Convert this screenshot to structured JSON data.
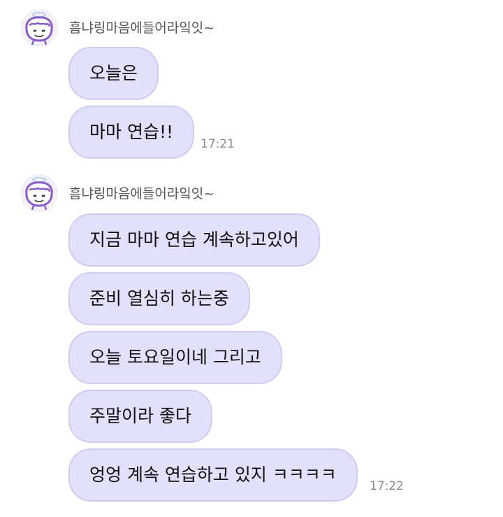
{
  "messages": [
    {
      "sender": "흠냐링마음에들어라잌잇~",
      "bubbles": [
        "오늘은",
        "마마 연습!!"
      ],
      "time": "17:21"
    },
    {
      "sender": "흠냐링마음에들어라잌잇~",
      "bubbles": [
        "지금 마마 연습 계속하고있어",
        "준비 열심히 하는중",
        "오늘 토요일이네 그리고",
        "주말이라 좋다",
        "엉엉 계속 연습하고 있지 ㅋㅋㅋㅋ"
      ],
      "time": "17:22"
    }
  ],
  "colors": {
    "bubble_bg": "#e2e0fb",
    "bubble_border": "#cfccf3",
    "avatar_accent": "#8a5cc7"
  },
  "icons": {
    "avatar": "cartoon-face-with-halo-icon"
  }
}
